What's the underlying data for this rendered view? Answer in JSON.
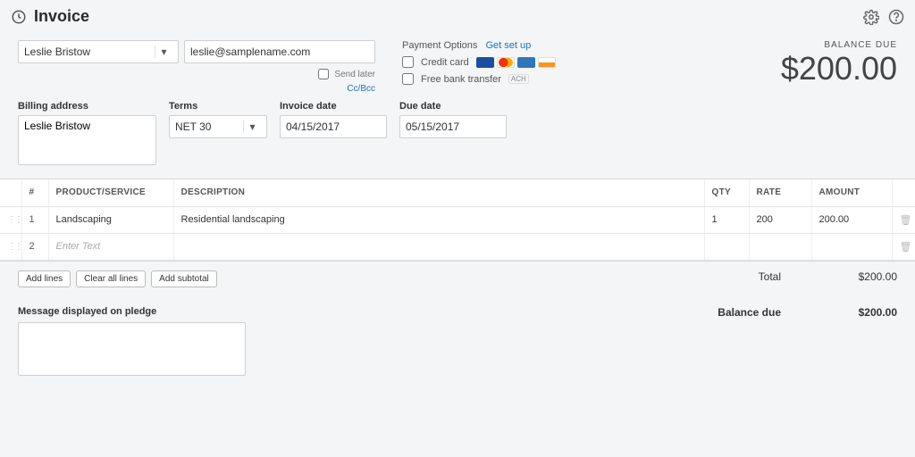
{
  "header": {
    "title": "Invoice"
  },
  "customer": {
    "name": "Leslie Bristow",
    "email": "leslie@samplename.com",
    "send_later_label": "Send later",
    "ccbcc_label": "Cc/Bcc"
  },
  "payment": {
    "header": "Payment Options",
    "setup_link": "Get set up",
    "credit_card_label": "Credit card",
    "bank_transfer_label": "Free bank transfer",
    "ach_label": "ACH"
  },
  "balance": {
    "label": "BALANCE DUE",
    "amount": "$200.00"
  },
  "fields": {
    "billing_label": "Billing address",
    "billing_value": "Leslie Bristow",
    "terms_label": "Terms",
    "terms_value": "NET 30",
    "invoice_date_label": "Invoice date",
    "invoice_date_value": "04/15/2017",
    "due_date_label": "Due date",
    "due_date_value": "05/15/2017"
  },
  "table": {
    "headers": {
      "num": "#",
      "product": "PRODUCT/SERVICE",
      "description": "DESCRIPTION",
      "qty": "QTY",
      "rate": "RATE",
      "amount": "AMOUNT"
    },
    "rows": [
      {
        "num": "1",
        "product": "Landscaping",
        "description": "Residential landscaping",
        "qty": "1",
        "rate": "200",
        "amount": "200.00"
      },
      {
        "num": "2",
        "product_placeholder": "Enter Text",
        "description": "",
        "qty": "",
        "rate": "",
        "amount": ""
      }
    ]
  },
  "buttons": {
    "add_lines": "Add lines",
    "clear_all": "Clear all lines",
    "add_subtotal": "Add subtotal"
  },
  "totals": {
    "total_label": "Total",
    "total_value": "$200.00",
    "balance_due_label": "Balance due",
    "balance_due_value": "$200.00"
  },
  "message": {
    "label": "Message displayed on pledge",
    "value": ""
  }
}
